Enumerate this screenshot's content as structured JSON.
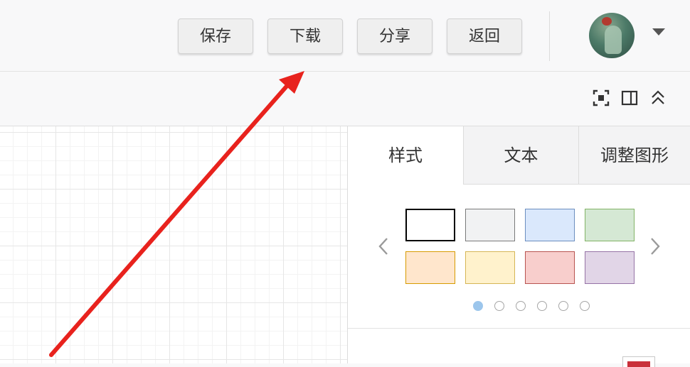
{
  "header": {
    "buttons": {
      "save": "保存",
      "download": "下载",
      "share": "分享",
      "back": "返回"
    }
  },
  "panel": {
    "tabs": [
      "样式",
      "文本",
      "调整图形"
    ],
    "active_tab": 0,
    "style_presets": [
      {
        "fill": "#ffffff",
        "stroke": "#000000"
      },
      {
        "fill": "#f1f2f3",
        "stroke": "#7a7a7a"
      },
      {
        "fill": "#dae8fc",
        "stroke": "#6c8ebf"
      },
      {
        "fill": "#d5e8d4",
        "stroke": "#82b366"
      },
      {
        "fill": "#ffe6cc",
        "stroke": "#d79b00"
      },
      {
        "fill": "#fff2cc",
        "stroke": "#d6b656"
      },
      {
        "fill": "#f8cecc",
        "stroke": "#b85450"
      },
      {
        "fill": "#e1d5e7",
        "stroke": "#9673a6"
      }
    ],
    "page_dots": 6,
    "active_page": 0
  },
  "colors": {
    "annotation_arrow": "#e8221d",
    "active_dot": "#9cc6ec",
    "corner_color": "#c9303a"
  },
  "icons": [
    "fit-view-icon",
    "toggle-panel-icon",
    "collapse-icon",
    "chevron-left-icon",
    "chevron-right-icon",
    "chevron-down-icon"
  ]
}
